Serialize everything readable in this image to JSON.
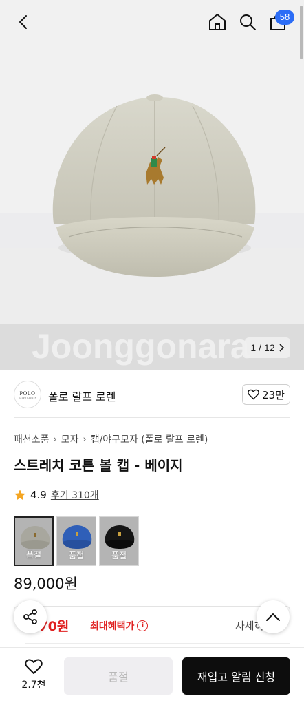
{
  "header": {
    "cart_count": "58"
  },
  "gallery": {
    "current": "1",
    "separator": "/",
    "total": "12",
    "watermark": "Joonggonara"
  },
  "brand": {
    "name": "폴로 랄프 로렌",
    "logo_text": "POLO",
    "logo_subtext": "RALPH LAUREN",
    "like_count": "23만"
  },
  "breadcrumb": [
    "패션소품",
    "모자",
    "캡/야구모자 (폴로 랄프 로렌)"
  ],
  "product": {
    "title": "스트레치 코튼 볼 캡 - 베이지",
    "rating": "4.9",
    "review_link": "후기 310개",
    "price": "89,000원"
  },
  "options": [
    {
      "color": "#a8a79e",
      "badge": "품절"
    },
    {
      "color": "#2f5fb8",
      "badge": "품절"
    },
    {
      "color": "#151515",
      "badge": "품절"
    }
  ],
  "benefit": {
    "price": ",670원",
    "label": "최대혜택가",
    "detail": "자세히"
  },
  "bottom": {
    "wish_count": "2.7천",
    "soldout_label": "품절",
    "restock_label": "재입고 알림 신청"
  },
  "colors": {
    "accent_blue": "#2c6df6",
    "benefit_red": "#e02121",
    "star": "#f5a623"
  }
}
